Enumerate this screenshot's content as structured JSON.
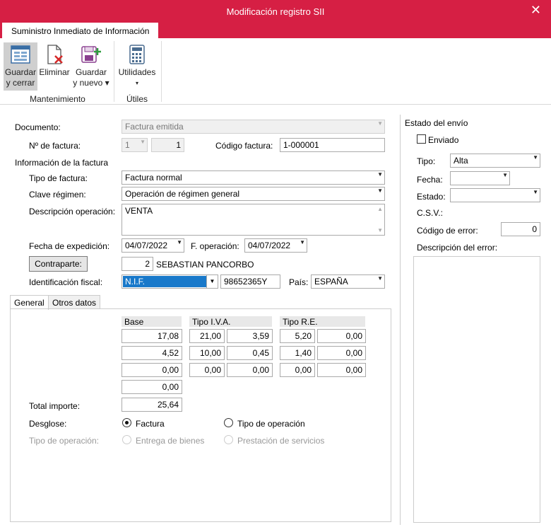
{
  "window": {
    "title": "Modificación registro SII"
  },
  "ribbon": {
    "tab": "Suministro Inmediato de Información",
    "buttons": {
      "save_close_1": "Guardar",
      "save_close_2": "y cerrar",
      "delete": "Eliminar",
      "save_new_1": "Guardar",
      "save_new_2": "y nuevo ▾",
      "utilities_1": "Utilidades",
      "utilities_2": "▾"
    },
    "groups": {
      "maintenance": "Mantenimiento",
      "utils": "Útiles"
    }
  },
  "form": {
    "documento_label": "Documento:",
    "documento": "Factura emitida",
    "nfactura_label": "Nº de factura:",
    "serie": "1",
    "numero": "1",
    "codigo_label": "Código factura:",
    "codigo": "1-000001",
    "info_section": "Información de la factura",
    "tipo_label": "Tipo de factura:",
    "tipo": "Factura normal",
    "clave_label": "Clave régimen:",
    "clave": "Operación de régimen general",
    "desc_label": "Descripción operación:",
    "desc": "VENTA",
    "fexp_label": "Fecha de expedición:",
    "fexp": "04/07/2022",
    "fop_label": "F. operación:",
    "fop": "04/07/2022",
    "contraparte_btn": "Contraparte:",
    "contraparte_num": "2",
    "contraparte_name": "SEBASTIAN PANCORBO",
    "idfiscal_label": "Identificación fiscal:",
    "idfiscal_type": "N.I.F.",
    "idfiscal_value": "98652365Y",
    "pais_label": "País:",
    "pais": "ESPAÑA"
  },
  "tabs": {
    "general": "General",
    "otros": "Otros datos"
  },
  "grid": {
    "headers": {
      "base": "Base",
      "iva": "Tipo I.V.A.",
      "re": "Tipo R.E."
    },
    "rows": [
      {
        "base": "17,08",
        "iva_pct": "21,00",
        "iva_amt": "3,59",
        "re_pct": "5,20",
        "re_amt": "0,00"
      },
      {
        "base": "4,52",
        "iva_pct": "10,00",
        "iva_amt": "0,45",
        "re_pct": "1,40",
        "re_amt": "0,00"
      },
      {
        "base": "0,00",
        "iva_pct": "0,00",
        "iva_amt": "0,00",
        "re_pct": "0,00",
        "re_amt": "0,00"
      }
    ],
    "subtotal": "0,00",
    "total_label": "Total importe:",
    "total": "25,64",
    "desglose_label": "Desglose:",
    "desglose_factura": "Factura",
    "desglose_tipo": "Tipo de operación",
    "tipoop_label": "Tipo de operación:",
    "entrega": "Entrega de bienes",
    "prestacion": "Prestación de servicios"
  },
  "estado": {
    "section": "Estado del envío",
    "enviado": "Enviado",
    "tipo_label": "Tipo:",
    "tipo": "Alta",
    "fecha_label": "Fecha:",
    "fecha": "",
    "estado_label": "Estado:",
    "estado": "",
    "csv_label": "C.S.V.:",
    "codigo_label": "Código de error:",
    "codigo": "0",
    "desc_label": "Descripción del error:"
  }
}
